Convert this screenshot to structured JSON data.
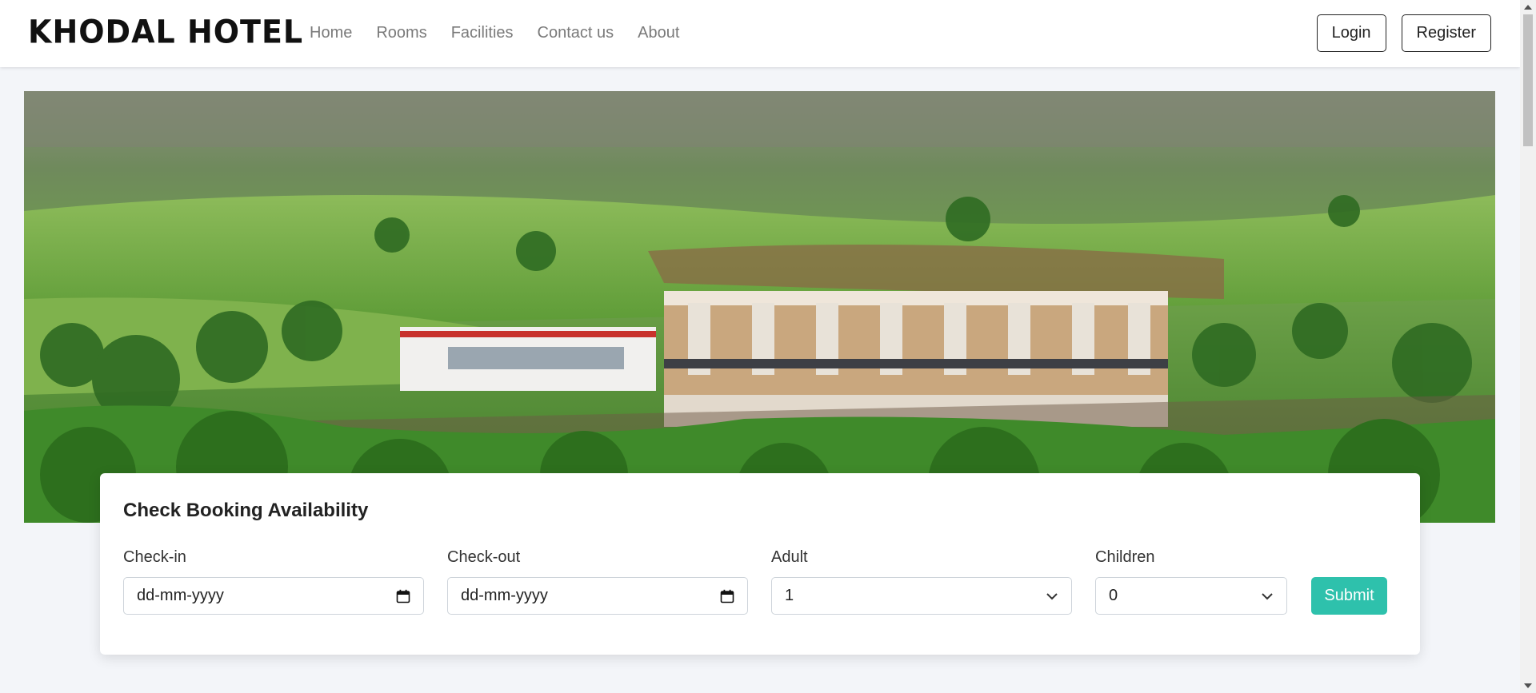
{
  "brand": "KHODAL HOTEL",
  "nav": {
    "links": [
      "Home",
      "Rooms",
      "Facilities",
      "Contact us",
      "About"
    ],
    "login_label": "Login",
    "register_label": "Register"
  },
  "booking": {
    "title": "Check Booking Availability",
    "checkin_label": "Check-in",
    "checkin_value": "dd-mm-yyyy",
    "checkout_label": "Check-out",
    "checkout_value": "dd-mm-yyyy",
    "adult_label": "Adult",
    "adult_value": "1",
    "children_label": "Children",
    "children_value": "0",
    "submit_label": "Submit"
  },
  "colors": {
    "accent": "#2ec1ac",
    "nav_text": "#7a7a7a",
    "page_bg": "#f3f5f9"
  }
}
